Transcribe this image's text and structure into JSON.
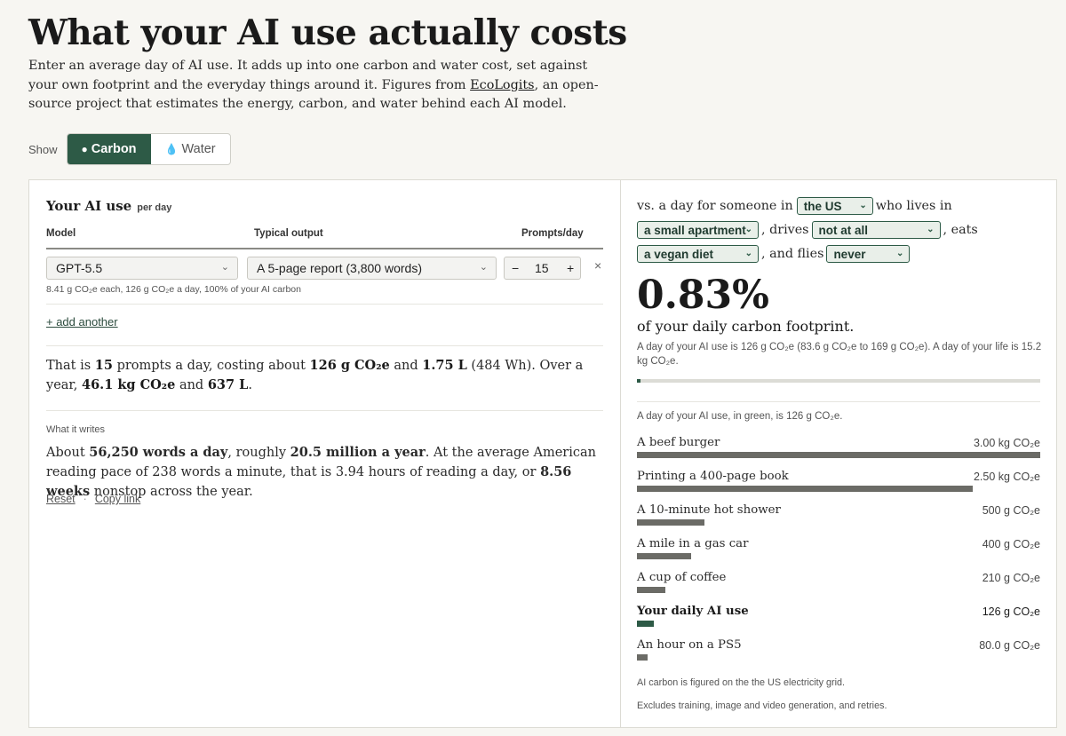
{
  "title": "What your AI use actually costs",
  "intro": {
    "before": "Enter an average day of AI use. It adds up into one carbon and water cost, set against your own footprint and the everyday things around it. Figures from ",
    "link": "EcoLogits",
    "after": ", an open-source project that estimates the energy, carbon, and water behind each AI model."
  },
  "show": {
    "label": "Show",
    "options": [
      {
        "label": "Carbon",
        "icon": "carbon-icon",
        "active": true
      },
      {
        "label": "Water",
        "icon": "water-drop-icon",
        "active": false
      }
    ]
  },
  "left": {
    "heading": "Your AI use",
    "heading_sub": "per day",
    "col_model": "Model",
    "col_output": "Typical output",
    "col_prompts": "Prompts/day",
    "model": "GPT-5.5",
    "output": "A 5-page report (3,800 words)",
    "prompts": "15",
    "minus": "−",
    "plus": "+",
    "remove": "×",
    "row_note": "8.41 g CO₂e each, 126 g CO₂e a day, 100% of your AI carbon",
    "add": "+ add another",
    "summary": {
      "t1": "That is ",
      "prompts": "15",
      "t2": " prompts a day, costing about ",
      "carbon": "126 g CO₂e",
      "t3": " and ",
      "water": "1.75 L",
      "t4": " (484 Wh). Over a year, ",
      "year_carbon": "46.1 kg CO₂e",
      "t5": " and ",
      "year_water": "637 L",
      "t6": "."
    },
    "writes_label": "What it writes",
    "writes": {
      "t1": "About ",
      "words_day": "56,250 words a day",
      "t2": ", roughly ",
      "words_year": "20.5 million a year",
      "t3": ". At the average American reading pace of 238 words a minute, that is 3.94 hours of reading a day, or ",
      "weeks": "8.56 weeks",
      "t4": " nonstop across the year."
    },
    "reset": "Reset",
    "sep": "·",
    "copy": "Copy link"
  },
  "right": {
    "s1": "vs. a day for someone in",
    "country": "the US",
    "s2": "who lives in",
    "home": "a small apartment",
    "s3": ", drives",
    "drives": "not at all",
    "s4": ", eats",
    "diet": "a vegan diet",
    "s5": ", and flies",
    "flies": "never",
    "percent": "0.83%",
    "percent_sub": "of your daily carbon footprint.",
    "detail": "A day of your AI use is 126 g CO₂e (83.6 g CO₂e to 169 g CO₂e). A day of your life is 15.2 kg CO₂e.",
    "share_fraction": 0.0083,
    "compare_note": "A day of your AI use, in green, is 126 g CO₂e.",
    "items": [
      {
        "label": "A beef burger",
        "value_text": "3.00 kg CO₂e",
        "value_g": 3000,
        "ai": false
      },
      {
        "label": "Printing a 400-page book",
        "value_text": "2.50 kg CO₂e",
        "value_g": 2500,
        "ai": false
      },
      {
        "label": "A 10-minute hot shower",
        "value_text": "500 g CO₂e",
        "value_g": 500,
        "ai": false
      },
      {
        "label": "A mile in a gas car",
        "value_text": "400 g CO₂e",
        "value_g": 400,
        "ai": false
      },
      {
        "label": "A cup of coffee",
        "value_text": "210 g CO₂e",
        "value_g": 210,
        "ai": false
      },
      {
        "label": "Your daily AI use",
        "value_text": "126 g CO₂e",
        "value_g": 126,
        "ai": true
      },
      {
        "label": "An hour on a PS5",
        "value_text": "80.0 g CO₂e",
        "value_g": 80,
        "ai": false
      }
    ],
    "footnote1": "AI carbon is figured on the the US electricity grid.",
    "footnote2": "Excludes training, image and video generation, and retries."
  },
  "colors": {
    "accent": "#2d5a46",
    "bar": "#6b6b66",
    "background": "#f7f6f2"
  }
}
